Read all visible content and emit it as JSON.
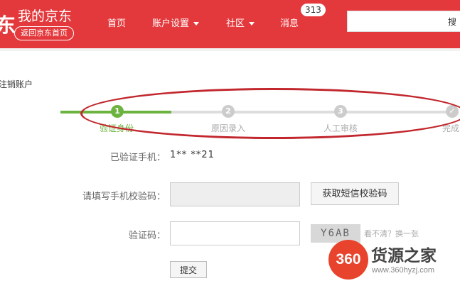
{
  "header": {
    "logo_fragment": "东",
    "brand": "我的京东",
    "back_home": "返回京东首页",
    "nav": [
      {
        "label": "首页"
      },
      {
        "label": "账户设置"
      },
      {
        "label": "社区"
      },
      {
        "label": "消息"
      }
    ],
    "message_count": "313",
    "search_button": "搜"
  },
  "page": {
    "title": "注销账户"
  },
  "steps": [
    {
      "num": "1",
      "label": "验证身份",
      "active": true
    },
    {
      "num": "2",
      "label": "原因录入",
      "active": false
    },
    {
      "num": "3",
      "label": "人工审核",
      "active": false
    },
    {
      "num": "✓",
      "label": "完成",
      "active": false
    }
  ],
  "form": {
    "phone_label": "已验证手机：",
    "phone_value": "1**      **21",
    "sms_label": "请填写手机校验码：",
    "sms_button": "获取短信校验码",
    "code_label": "验证码：",
    "captcha_text": "Y6AB",
    "captcha_hint": "看不清？换一张",
    "submit": "提交"
  },
  "watermark": {
    "badge": "360",
    "title": "货源之家",
    "url": "www.360hyzj.com"
  },
  "colors": {
    "brand_red": "#e4393c",
    "step_green": "#6cb33f",
    "annotation_red": "#c1272d"
  }
}
